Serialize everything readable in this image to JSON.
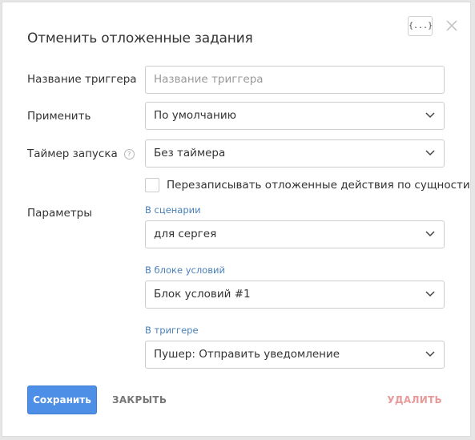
{
  "dialog": {
    "title": "Отменить отложенные задания",
    "code_button_label": "{...}",
    "close_icon": "close-icon"
  },
  "trigger_name": {
    "label": "Название триггера",
    "value": "",
    "placeholder": "Название триггера"
  },
  "apply": {
    "label": "Применить",
    "selected": "По умолчанию"
  },
  "launch_timer": {
    "label": "Таймер запуска",
    "help_icon": "question-icon",
    "selected": "Без таймера"
  },
  "overwrite": {
    "label": "Перезаписывать отложенные действия по сущности",
    "checked": false
  },
  "parameters": {
    "label": "Параметры",
    "scenario": {
      "label": "В сценарии",
      "selected": "для сергея"
    },
    "condition_block": {
      "label": "В блоке условий",
      "selected": "Блок условий #1"
    },
    "trigger": {
      "label": "В триггере",
      "selected": "Пушер: Отправить уведомление"
    }
  },
  "footer": {
    "save_label": "Сохранить",
    "close_label": "ЗАКРЫТЬ",
    "delete_label": "УДАЛИТЬ"
  },
  "colors": {
    "primary": "#4d8fe6",
    "link_label": "#4a80b7",
    "delete": "#e89a9a"
  }
}
